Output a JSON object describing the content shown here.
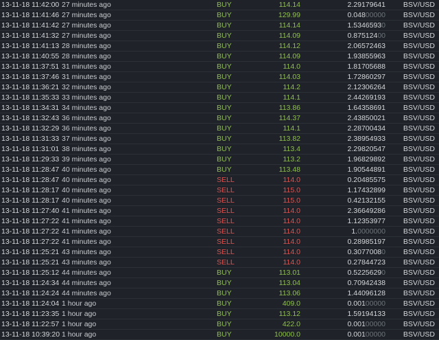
{
  "colors": {
    "buy": "#8fc04a",
    "sell": "#e0524f",
    "background": "#1f2329",
    "text": "#d6d8db",
    "dim": "#6c737b"
  },
  "trades": [
    {
      "time": "13-11-18 11:42:00",
      "ago": "27 minutes ago",
      "side": "BUY",
      "price": "114.14",
      "amount": "2.29179641",
      "amount_dim": "",
      "pair": "BSV/USD"
    },
    {
      "time": "13-11-18 11:41:46",
      "ago": "27 minutes ago",
      "side": "BUY",
      "price": "129.99",
      "amount": "0.048",
      "amount_dim": "00000",
      "pair": "BSV/USD"
    },
    {
      "time": "13-11-18 11:41:42",
      "ago": "27 minutes ago",
      "side": "BUY",
      "price": "114.14",
      "amount": "1.5346593",
      "amount_dim": "0",
      "pair": "BSV/USD"
    },
    {
      "time": "13-11-18 11:41:32",
      "ago": "27 minutes ago",
      "side": "BUY",
      "price": "114.09",
      "amount": "0.875124",
      "amount_dim": "00",
      "pair": "BSV/USD"
    },
    {
      "time": "13-11-18 11:41:13",
      "ago": "28 minutes ago",
      "side": "BUY",
      "price": "114.12",
      "amount": "2.06572463",
      "amount_dim": "",
      "pair": "BSV/USD"
    },
    {
      "time": "13-11-18 11:40:55",
      "ago": "28 minutes ago",
      "side": "BUY",
      "price": "114.09",
      "amount": "1.93855963",
      "amount_dim": "",
      "pair": "BSV/USD"
    },
    {
      "time": "13-11-18 11:37:51",
      "ago": "31 minutes ago",
      "side": "BUY",
      "price": "114.0",
      "amount": "1.81705688",
      "amount_dim": "",
      "pair": "BSV/USD"
    },
    {
      "time": "13-11-18 11:37:46",
      "ago": "31 minutes ago",
      "side": "BUY",
      "price": "114.03",
      "amount": "1.72860297",
      "amount_dim": "",
      "pair": "BSV/USD"
    },
    {
      "time": "13-11-18 11:36:21",
      "ago": "32 minutes ago",
      "side": "BUY",
      "price": "114.2",
      "amount": "2.12306264",
      "amount_dim": "",
      "pair": "BSV/USD"
    },
    {
      "time": "13-11-18 11:35:33",
      "ago": "33 minutes ago",
      "side": "BUY",
      "price": "114.1",
      "amount": "2.44269193",
      "amount_dim": "",
      "pair": "BSV/USD"
    },
    {
      "time": "13-11-18 11:34:31",
      "ago": "34 minutes ago",
      "side": "BUY",
      "price": "113.86",
      "amount": "1.64358691",
      "amount_dim": "",
      "pair": "BSV/USD"
    },
    {
      "time": "13-11-18 11:32:43",
      "ago": "36 minutes ago",
      "side": "BUY",
      "price": "114.37",
      "amount": "2.43850021",
      "amount_dim": "",
      "pair": "BSV/USD"
    },
    {
      "time": "13-11-18 11:32:29",
      "ago": "36 minutes ago",
      "side": "BUY",
      "price": "114.1",
      "amount": "2.28700434",
      "amount_dim": "",
      "pair": "BSV/USD"
    },
    {
      "time": "13-11-18 11:31:33",
      "ago": "37 minutes ago",
      "side": "BUY",
      "price": "113.82",
      "amount": "2.38954933",
      "amount_dim": "",
      "pair": "BSV/USD"
    },
    {
      "time": "13-11-18 11:31:01",
      "ago": "38 minutes ago",
      "side": "BUY",
      "price": "113.4",
      "amount": "2.29820547",
      "amount_dim": "",
      "pair": "BSV/USD"
    },
    {
      "time": "13-11-18 11:29:33",
      "ago": "39 minutes ago",
      "side": "BUY",
      "price": "113.2",
      "amount": "1.96829892",
      "amount_dim": "",
      "pair": "BSV/USD"
    },
    {
      "time": "13-11-18 11:28:47",
      "ago": "40 minutes ago",
      "side": "BUY",
      "price": "113.48",
      "amount": "1.90544891",
      "amount_dim": "",
      "pair": "BSV/USD"
    },
    {
      "time": "13-11-18 11:28:47",
      "ago": "40 minutes ago",
      "side": "SELL",
      "price": "114.0",
      "amount": "0.20485575",
      "amount_dim": "",
      "pair": "BSV/USD"
    },
    {
      "time": "13-11-18 11:28:17",
      "ago": "40 minutes ago",
      "side": "SELL",
      "price": "115.0",
      "amount": "1.17432899",
      "amount_dim": "",
      "pair": "BSV/USD"
    },
    {
      "time": "13-11-18 11:28:17",
      "ago": "40 minutes ago",
      "side": "SELL",
      "price": "115.0",
      "amount": "0.42132155",
      "amount_dim": "",
      "pair": "BSV/USD"
    },
    {
      "time": "13-11-18 11:27:40",
      "ago": "41 minutes ago",
      "side": "SELL",
      "price": "114.0",
      "amount": "2.36649286",
      "amount_dim": "",
      "pair": "BSV/USD"
    },
    {
      "time": "13-11-18 11:27:22",
      "ago": "41 minutes ago",
      "side": "SELL",
      "price": "114.0",
      "amount": "1.12353977",
      "amount_dim": "",
      "pair": "BSV/USD"
    },
    {
      "time": "13-11-18 11:27:22",
      "ago": "41 minutes ago",
      "side": "SELL",
      "price": "114.0",
      "amount": "1.",
      "amount_dim": "0000000",
      "pair": "BSV/USD"
    },
    {
      "time": "13-11-18 11:27:22",
      "ago": "41 minutes ago",
      "side": "SELL",
      "price": "114.0",
      "amount": "0.28985197",
      "amount_dim": "",
      "pair": "BSV/USD"
    },
    {
      "time": "13-11-18 11:25:21",
      "ago": "43 minutes ago",
      "side": "SELL",
      "price": "114.0",
      "amount": "0.3077008",
      "amount_dim": "0",
      "pair": "BSV/USD"
    },
    {
      "time": "13-11-18 11:25:21",
      "ago": "43 minutes ago",
      "side": "SELL",
      "price": "114.0",
      "amount": "0.27844723",
      "amount_dim": "",
      "pair": "BSV/USD"
    },
    {
      "time": "13-11-18 11:25:12",
      "ago": "44 minutes ago",
      "side": "BUY",
      "price": "113.01",
      "amount": "0.5225629",
      "amount_dim": "0",
      "pair": "BSV/USD"
    },
    {
      "time": "13-11-18 11:24:34",
      "ago": "44 minutes ago",
      "side": "BUY",
      "price": "113.04",
      "amount": "0.70942438",
      "amount_dim": "",
      "pair": "BSV/USD"
    },
    {
      "time": "13-11-18 11:24:24",
      "ago": "44 minutes ago",
      "side": "BUY",
      "price": "113.06",
      "amount": "1.44096128",
      "amount_dim": "",
      "pair": "BSV/USD"
    },
    {
      "time": "13-11-18 11:24:04",
      "ago": "1 hour ago",
      "side": "BUY",
      "price": "409.0",
      "amount": "0.001",
      "amount_dim": "00000",
      "pair": "BSV/USD"
    },
    {
      "time": "13-11-18 11:23:35",
      "ago": "1 hour ago",
      "side": "BUY",
      "price": "113.12",
      "amount": "1.59194133",
      "amount_dim": "",
      "pair": "BSV/USD"
    },
    {
      "time": "13-11-18 11:22:57",
      "ago": "1 hour ago",
      "side": "BUY",
      "price": "422.0",
      "amount": "0.001",
      "amount_dim": "00000",
      "pair": "BSV/USD"
    },
    {
      "time": "13-11-18 10:39:20",
      "ago": "1 hour ago",
      "side": "BUY",
      "price": "10000.0",
      "amount": "0.001",
      "amount_dim": "00000",
      "pair": "BSV/USD"
    }
  ]
}
